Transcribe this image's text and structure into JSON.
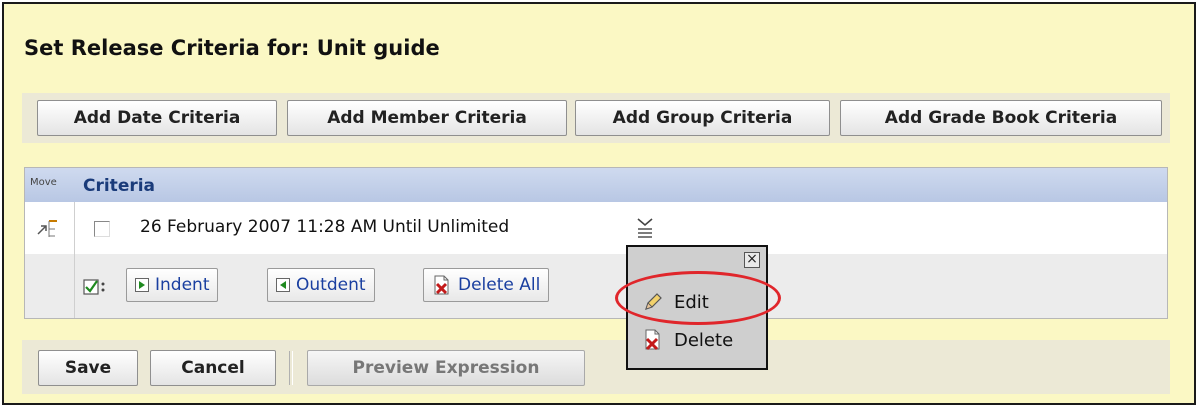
{
  "page": {
    "title": "Set Release Criteria for: Unit guide"
  },
  "toolbar": {
    "add_date": "Add Date Criteria",
    "add_member": "Add Member Criteria",
    "add_group": "Add Group Criteria",
    "add_gradebook": "Add Grade Book Criteria"
  },
  "table": {
    "move_label": "Move",
    "criteria_header": "Criteria",
    "rows": [
      {
        "text": "26 February 2007 11:28 AM Until Unlimited",
        "checked": false
      }
    ],
    "actions": {
      "indent": "Indent",
      "outdent": "Outdent",
      "delete_all": "Delete All"
    }
  },
  "context_menu": {
    "close": "×",
    "items": [
      {
        "label": "Edit",
        "icon": "pencil-icon"
      },
      {
        "label": "Delete",
        "icon": "delete-icon"
      }
    ]
  },
  "footer": {
    "save": "Save",
    "cancel": "Cancel",
    "preview": "Preview Expression"
  },
  "colors": {
    "background": "#fbf8c4",
    "header": "#c6d3ec",
    "highlight": "#e0262b",
    "link": "#1a3fa0"
  }
}
